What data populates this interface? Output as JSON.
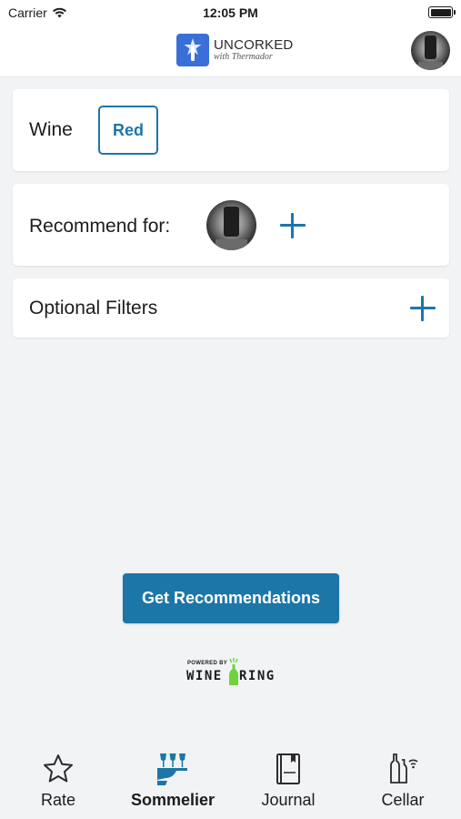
{
  "status_bar": {
    "carrier": "Carrier",
    "time": "12:05 PM"
  },
  "header": {
    "brand_title": "UNCORKED",
    "brand_subtitle": "with Thermador"
  },
  "wine_card": {
    "label": "Wine",
    "selected_type": "Red"
  },
  "recommend_card": {
    "label": "Recommend for:"
  },
  "filters_card": {
    "label": "Optional Filters"
  },
  "cta": {
    "label": "Get Recommendations"
  },
  "powered": {
    "prefix": "POWERED BY",
    "brand_left": "WINE",
    "brand_right": "RING"
  },
  "tabs": [
    {
      "label": "Rate",
      "icon": "star-icon",
      "active": false
    },
    {
      "label": "Sommelier",
      "icon": "sommelier-icon",
      "active": true
    },
    {
      "label": "Journal",
      "icon": "journal-icon",
      "active": false
    },
    {
      "label": "Cellar",
      "icon": "cellar-icon",
      "active": false
    }
  ],
  "colors": {
    "accent": "#1c76a8",
    "background": "#f2f3f5",
    "card": "#ffffff",
    "brand_logo": "#3a6fd8",
    "wine_ring_green": "#6fd23a"
  }
}
